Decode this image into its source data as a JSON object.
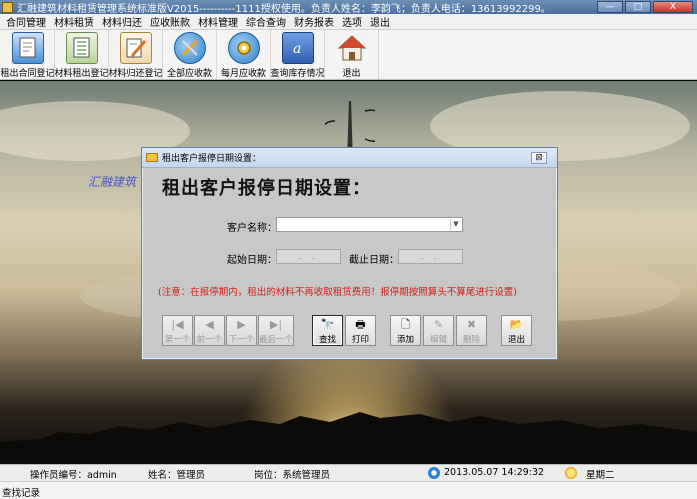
{
  "window": {
    "title": "汇融建筑材料租赁管理系统标准版V2015----------1111授权使用。负责人姓名：李韵飞；负责人电话：13613992299。",
    "buttons": {
      "minimize": "—",
      "maximize": "□",
      "close": "X"
    }
  },
  "menu": [
    "合同管理",
    "材料租赁",
    "材料归还",
    "应收账款",
    "材料管理",
    "综合查询",
    "财务报表",
    "选项",
    "退出"
  ],
  "toolbar": [
    {
      "label": "租出合同登记",
      "icon": "contract-doc-icon",
      "color": "#4a8fd8"
    },
    {
      "label": "材料租出登记",
      "icon": "list-doc-icon",
      "color": "#6a9e4f"
    },
    {
      "label": "材料归还登记",
      "icon": "pencil-doc-icon",
      "color": "#d99a2b"
    },
    {
      "label": "全部应收款",
      "icon": "tools-globe-icon",
      "color": "#3d8fd1"
    },
    {
      "label": "每月应收款",
      "icon": "gear-globe-icon",
      "color": "#3d8fd1"
    },
    {
      "label": "查询库存情况",
      "icon": "address-book-icon",
      "color": "#3a6fc4"
    },
    {
      "label": "退出",
      "icon": "home-icon",
      "color": "#c84a2a"
    }
  ],
  "background": {
    "brand_text": "汇融建筑"
  },
  "dialog": {
    "title": "租出客户报停日期设置：",
    "close": "⊠",
    "heading": "租出客户报停日期设置：",
    "customer_label": "客户名称：",
    "customer_value": "",
    "start_label": "起始日期：",
    "end_label": "截止日期：",
    "date_placeholder": ". .",
    "note": "(注意：在报停期内，租出的材料不再收取租赁费用！报停期按照算头不算尾进行设置)",
    "buttons": [
      {
        "label": "第一个",
        "glyph": "|◀",
        "state": "disabled"
      },
      {
        "label": "前一个",
        "glyph": "◀",
        "state": "disabled"
      },
      {
        "label": "下一个",
        "glyph": "▶",
        "state": "disabled"
      },
      {
        "label": "最后一个",
        "glyph": "▶|",
        "state": "disabled"
      },
      {
        "label": "查找",
        "glyph": "🔭",
        "state": "active"
      },
      {
        "label": "打印",
        "glyph": "🖶",
        "state": "normal"
      },
      {
        "label": "添加",
        "glyph": "🗋",
        "state": "normal"
      },
      {
        "label": "编辑",
        "glyph": "✎",
        "state": "disabled"
      },
      {
        "label": "删除",
        "glyph": "✖",
        "state": "disabled"
      },
      {
        "label": "退出",
        "glyph": "📂",
        "state": "normal"
      }
    ]
  },
  "status": {
    "operator": "操作员编号：admin",
    "name": "姓名：管理员",
    "post": "岗位：系统管理员",
    "datetime": "2013.05.07  14:29:32",
    "weekday": "星期二",
    "bottom": "查找记录"
  }
}
